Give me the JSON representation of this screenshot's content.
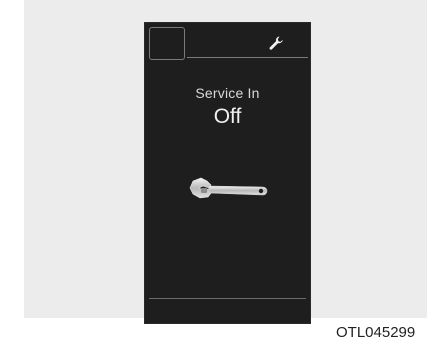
{
  "display": {
    "title": "Service In",
    "value": "Off",
    "header_icon": "wrench-icon",
    "main_icon": "adjustable-wrench-icon"
  },
  "figure_code": "OTL045299"
}
